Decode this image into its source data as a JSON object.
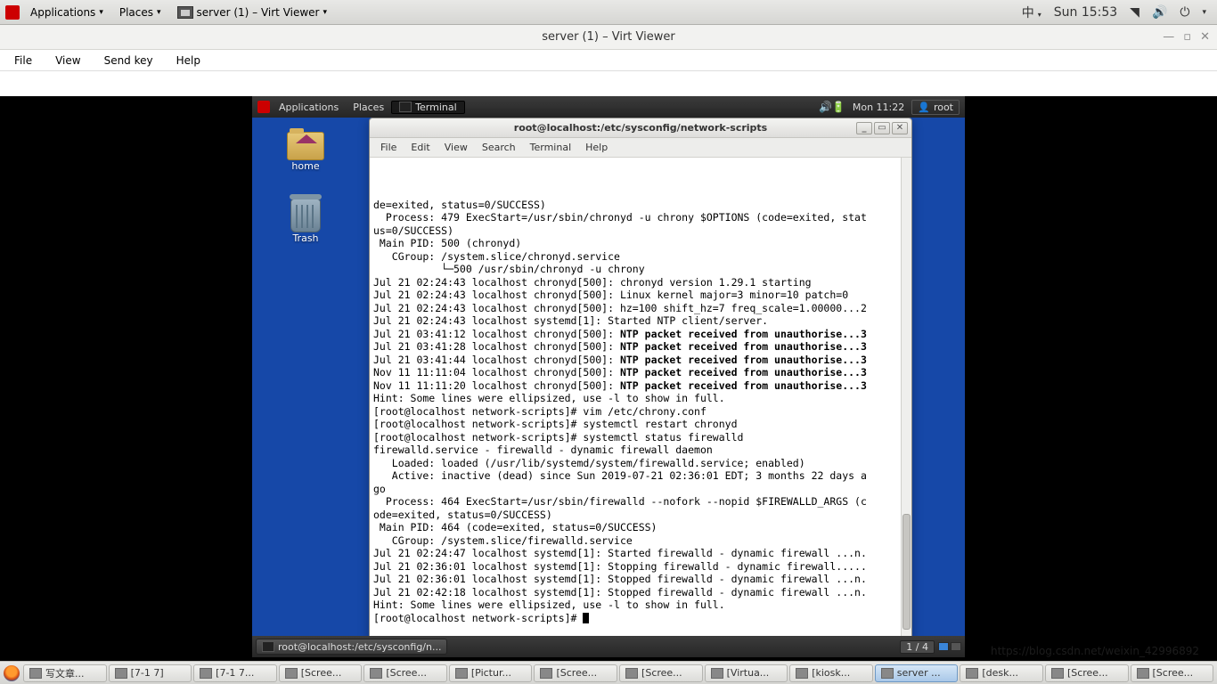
{
  "host_panel": {
    "applications": "Applications",
    "places": "Places",
    "active_window": "server (1) – Virt Viewer",
    "ime": "中",
    "clock": "Sun 15:53"
  },
  "app": {
    "title": "server (1) – Virt Viewer",
    "menu": {
      "file": "File",
      "view": "View",
      "sendkey": "Send key",
      "help": "Help"
    }
  },
  "guest_panel": {
    "applications": "Applications",
    "places": "Places",
    "terminal": "Terminal",
    "clock": "Mon 11:22",
    "user": "root"
  },
  "desktop": {
    "home": "home",
    "trash": "Trash"
  },
  "term": {
    "title": "root@localhost:/etc/sysconfig/network-scripts",
    "menu": {
      "file": "File",
      "edit": "Edit",
      "view": "View",
      "search": "Search",
      "terminal": "Terminal",
      "help": "Help"
    },
    "lines": [
      {
        "t": "de=exited, status=0/SUCCESS)"
      },
      {
        "t": "  Process: 479 ExecStart=/usr/sbin/chronyd -u chrony $OPTIONS (code=exited, stat"
      },
      {
        "t": "us=0/SUCCESS)"
      },
      {
        "t": " Main PID: 500 (chronyd)"
      },
      {
        "t": "   CGroup: /system.slice/chronyd.service"
      },
      {
        "t": "           └─500 /usr/sbin/chronyd -u chrony"
      },
      {
        "t": ""
      },
      {
        "t": "Jul 21 02:24:43 localhost chronyd[500]: chronyd version 1.29.1 starting"
      },
      {
        "t": "Jul 21 02:24:43 localhost chronyd[500]: Linux kernel major=3 minor=10 patch=0"
      },
      {
        "t": "Jul 21 02:24:43 localhost chronyd[500]: hz=100 shift_hz=7 freq_scale=1.00000...2"
      },
      {
        "t": "Jul 21 02:24:43 localhost systemd[1]: Started NTP client/server."
      },
      {
        "p": "Jul 21 03:41:12 localhost chronyd[500]: ",
        "b": "NTP packet received from unauthorise...3"
      },
      {
        "p": "Jul 21 03:41:28 localhost chronyd[500]: ",
        "b": "NTP packet received from unauthorise...3"
      },
      {
        "p": "Jul 21 03:41:44 localhost chronyd[500]: ",
        "b": "NTP packet received from unauthorise...3"
      },
      {
        "p": "Nov 11 11:11:04 localhost chronyd[500]: ",
        "b": "NTP packet received from unauthorise...3"
      },
      {
        "p": "Nov 11 11:11:20 localhost chronyd[500]: ",
        "b": "NTP packet received from unauthorise...3"
      },
      {
        "t": "Hint: Some lines were ellipsized, use -l to show in full."
      },
      {
        "t": "[root@localhost network-scripts]# vim /etc/chrony.conf"
      },
      {
        "t": "[root@localhost network-scripts]# systemctl restart chronyd"
      },
      {
        "t": "[root@localhost network-scripts]# systemctl status firewalld"
      },
      {
        "t": "firewalld.service - firewalld - dynamic firewall daemon"
      },
      {
        "t": "   Loaded: loaded (/usr/lib/systemd/system/firewalld.service; enabled)"
      },
      {
        "t": "   Active: inactive (dead) since Sun 2019-07-21 02:36:01 EDT; 3 months 22 days a"
      },
      {
        "t": "go"
      },
      {
        "t": "  Process: 464 ExecStart=/usr/sbin/firewalld --nofork --nopid $FIREWALLD_ARGS (c"
      },
      {
        "t": "ode=exited, status=0/SUCCESS)"
      },
      {
        "t": " Main PID: 464 (code=exited, status=0/SUCCESS)"
      },
      {
        "t": "   CGroup: /system.slice/firewalld.service"
      },
      {
        "t": ""
      },
      {
        "t": "Jul 21 02:24:47 localhost systemd[1]: Started firewalld - dynamic firewall ...n."
      },
      {
        "t": "Jul 21 02:36:01 localhost systemd[1]: Stopping firewalld - dynamic firewall....."
      },
      {
        "t": "Jul 21 02:36:01 localhost systemd[1]: Stopped firewalld - dynamic firewall ...n."
      },
      {
        "t": "Jul 21 02:42:18 localhost systemd[1]: Stopped firewalld - dynamic firewall ...n."
      },
      {
        "t": "Hint: Some lines were ellipsized, use -l to show in full."
      },
      {
        "t": "[root@localhost network-scripts]# ",
        "cursor": true
      }
    ]
  },
  "guest_taskbar": {
    "task": "root@localhost:/etc/sysconfig/n...",
    "workspace": "1 / 4"
  },
  "host_taskbar": {
    "items": [
      {
        "label": "写文章...",
        "active": false
      },
      {
        "label": "[7-1 7]",
        "active": false
      },
      {
        "label": "[7-1 7...",
        "active": false
      },
      {
        "label": "[Scree...",
        "active": false
      },
      {
        "label": "[Scree...",
        "active": false
      },
      {
        "label": "[Pictur...",
        "active": false
      },
      {
        "label": "[Scree...",
        "active": false
      },
      {
        "label": "[Scree...",
        "active": false
      },
      {
        "label": "[Virtua...",
        "active": false
      },
      {
        "label": "[kiosk...",
        "active": false
      },
      {
        "label": "server ...",
        "active": true
      },
      {
        "label": "[desk...",
        "active": false
      },
      {
        "label": "[Scree...",
        "active": false
      },
      {
        "label": "[Scree...",
        "active": false
      }
    ]
  },
  "watermark": "https://blog.csdn.net/weixin_42996892"
}
